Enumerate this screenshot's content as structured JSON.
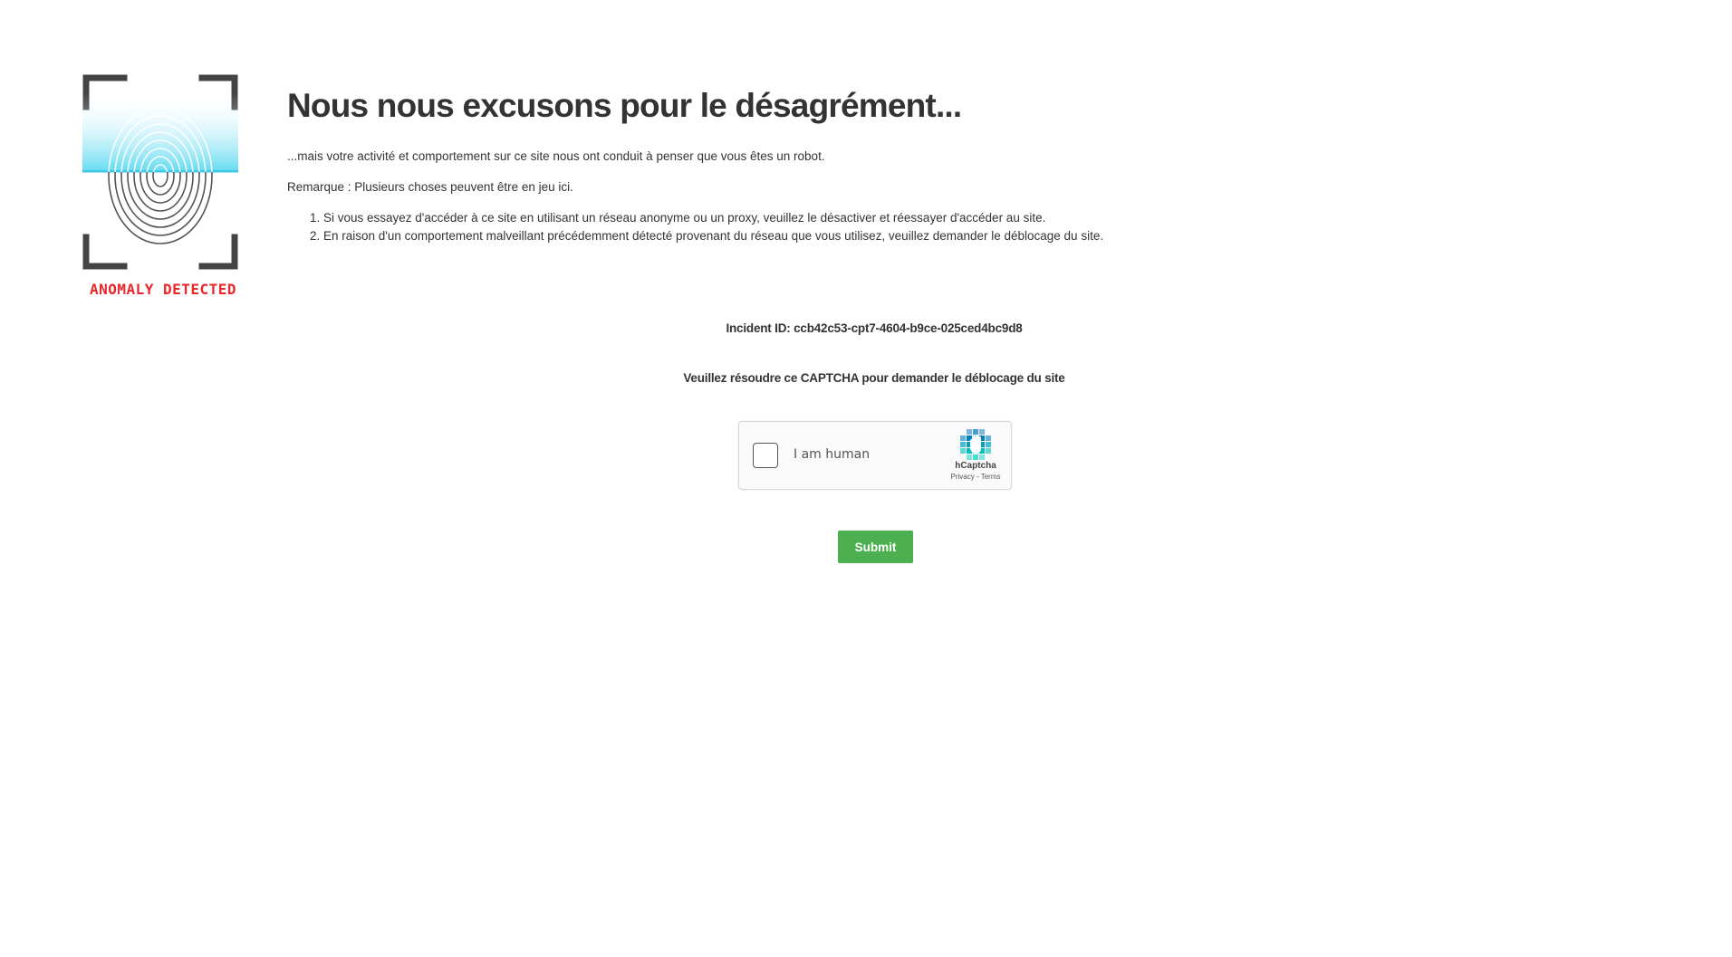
{
  "logo": {
    "icon": "fingerprint-scan-icon",
    "caption": "ANOMALY DETECTED",
    "caption_color": "#e8262b",
    "scan_color": "#5ad8f0"
  },
  "main": {
    "title": "Nous nous excusons pour le désagrément...",
    "intro": "...mais votre activité et comportement sur ce site nous ont conduit à penser que vous êtes un robot.",
    "remark": "Remarque : Plusieurs choses peuvent être en jeu ici.",
    "reasons": [
      "Si vous essayez d'accéder à ce site en utilisant un réseau anonyme ou un proxy, veuillez le désactiver et réessayer d'accéder au site.",
      "En raison d'un comportement malveillant précédemment détecté provenant du réseau que vous utilisez, veuillez demander le déblocage du site."
    ]
  },
  "incident": {
    "text": "Incident ID: ccb42c53-cpt7-4604-b9ce-025ced4bc9d8"
  },
  "captcha": {
    "prompt": "Veuillez résoudre ce CAPTCHA pour demander le déblocage du site",
    "checkbox_label": "I am human",
    "brand": "hCaptcha",
    "privacy_link": "Privacy",
    "separator": " - ",
    "terms_link": "Terms",
    "logo_icon": "hcaptcha-hand-icon"
  },
  "submit": {
    "label": "Submit",
    "color": "#4caf50"
  }
}
